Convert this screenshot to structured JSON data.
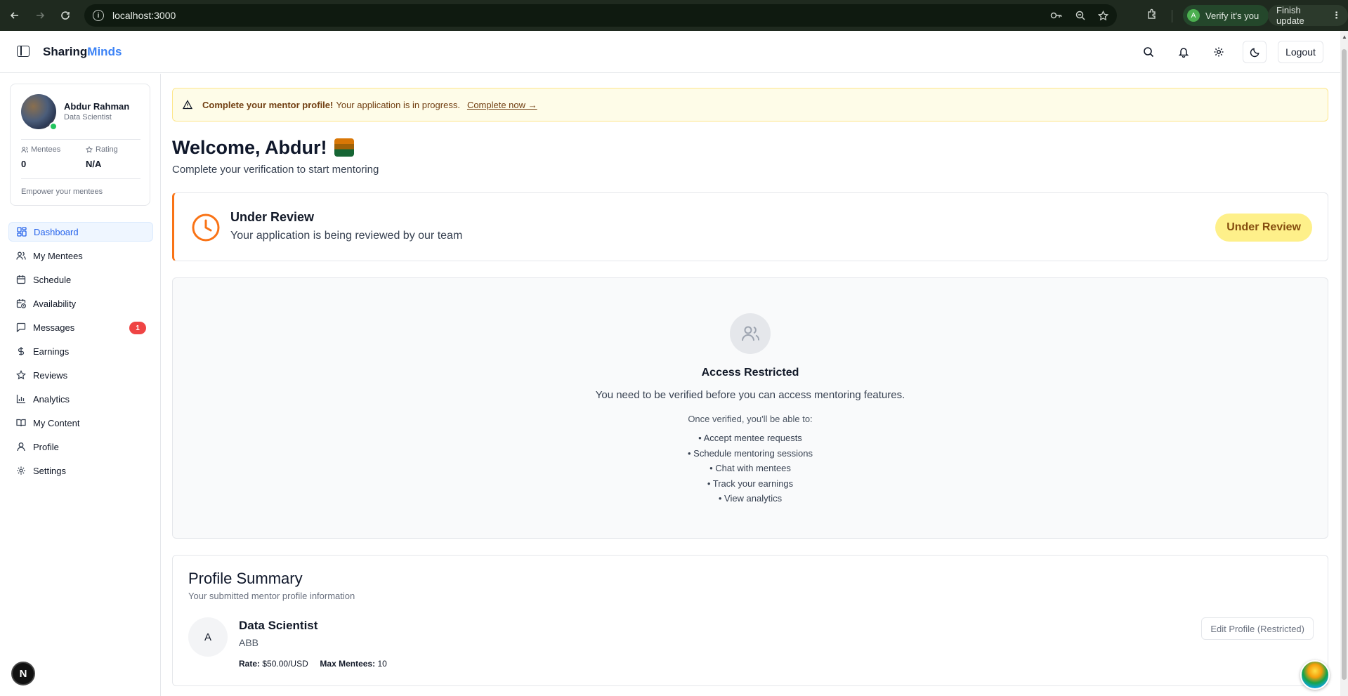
{
  "browser": {
    "url": "localhost:3000",
    "verify_label": "Verify it's you",
    "verify_avatar_letter": "A",
    "finish_label": "Finish update"
  },
  "header": {
    "brand_part1": "Sharing",
    "brand_part2": "Minds",
    "logout_label": "Logout"
  },
  "sidebar": {
    "profile": {
      "name": "Abdur Rahman",
      "role": "Data Scientist",
      "mentees_label": "Mentees",
      "mentees_value": "0",
      "rating_label": "Rating",
      "rating_value": "N/A",
      "tagline": "Empower your mentees"
    },
    "items": [
      {
        "label": "Dashboard",
        "icon": "layout-dashboard-icon",
        "active": true
      },
      {
        "label": "My Mentees",
        "icon": "users-icon"
      },
      {
        "label": "Schedule",
        "icon": "calendar-icon"
      },
      {
        "label": "Availability",
        "icon": "calendar-clock-icon"
      },
      {
        "label": "Messages",
        "icon": "message-square-icon",
        "badge": "1"
      },
      {
        "label": "Earnings",
        "icon": "dollar-sign-icon"
      },
      {
        "label": "Reviews",
        "icon": "star-icon"
      },
      {
        "label": "Analytics",
        "icon": "bar-chart-icon"
      },
      {
        "label": "My Content",
        "icon": "book-open-icon"
      },
      {
        "label": "Profile",
        "icon": "user-icon"
      },
      {
        "label": "Settings",
        "icon": "settings-icon"
      }
    ],
    "footer_badge": "N"
  },
  "main": {
    "alert": {
      "bold": "Complete your mentor profile!",
      "text": "Your application is in progress.",
      "link": "Complete now →"
    },
    "welcome_title": "Welcome, Abdur!",
    "welcome_subtitle": "Complete your verification to start mentoring",
    "review": {
      "title": "Under Review",
      "subtitle": "Your application is being reviewed by our team",
      "pill": "Under Review"
    },
    "restricted": {
      "title": "Access Restricted",
      "description": "You need to be verified before you can access mentoring features.",
      "intro": "Once verified, you'll be able to:",
      "items": [
        "• Accept mentee requests",
        "• Schedule mentoring sessions",
        "• Chat with mentees",
        "• Track your earnings",
        "• View analytics"
      ]
    },
    "summary": {
      "title": "Profile Summary",
      "subtitle": "Your submitted mentor profile information",
      "avatar_letter": "A",
      "name": "Data Scientist",
      "code": "ABB",
      "rate_label": "Rate:",
      "rate_value": "$50.00/USD",
      "max_label": "Max Mentees:",
      "max_value": "10",
      "edit_label": "Edit Profile (Restricted)"
    }
  },
  "colors": {
    "brand_accent": "#3b82f6",
    "review_accent": "#f97316",
    "badge": "#ef4444",
    "alert_bg": "#fefce8"
  }
}
